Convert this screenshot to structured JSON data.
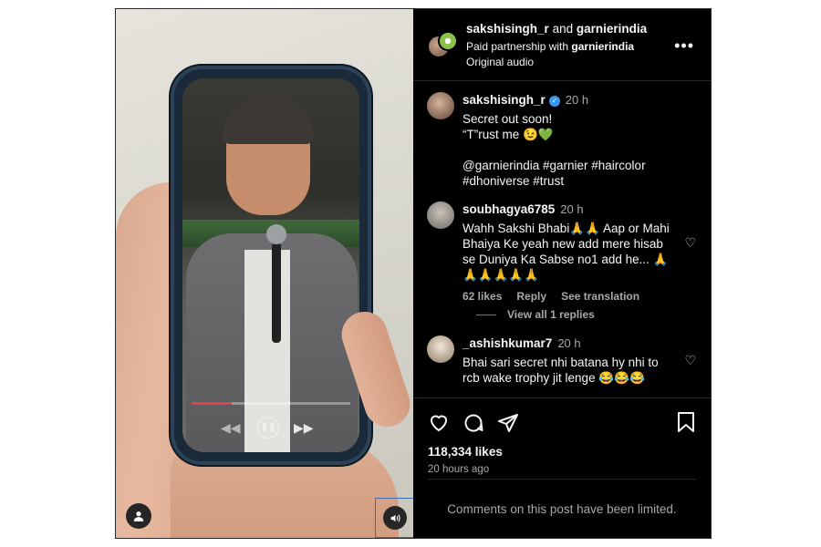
{
  "colors": {
    "background": "#000000",
    "text": "#f5f5f5",
    "muted": "#a8a8a8",
    "verified": "#3897f0",
    "divider": "#262626",
    "progress": "#e0434c"
  },
  "header": {
    "user1": "sakshisingh_r",
    "connector": "and",
    "user2": "garnierindia",
    "partnership_prefix": "Paid partnership with",
    "partnership_brand": "garnierindia",
    "audio": "Original audio",
    "more_icon": "more-horizontal-icon"
  },
  "caption": {
    "username": "sakshisingh_r",
    "time": "20 h",
    "text": "Secret out soon!\n“T”rust me 😉💚\n\n@garnierindia #garnier #haircolor\n#dhoniverse #trust"
  },
  "comments": [
    {
      "username": "soubhagya6785",
      "time": "20 h",
      "text": "Wahh Sakshi Bhabi🙏🙏 Aap or Mahi Bhaiya Ke yeah new add mere hisab se Duniya Ka Sabse no1 add he... 🙏\n🙏🙏🙏🙏🙏",
      "likes": "62 likes",
      "reply": "Reply",
      "translate": "See translation",
      "view_replies": "View all 1 replies"
    },
    {
      "username": "_ashishkumar7",
      "time": "20 h",
      "text": "Bhai sari secret nhi batana hy nhi to rcb wake trophy jit lenge 😂😂😂"
    }
  ],
  "actions": {
    "likes": "118,334 likes",
    "posted": "20 hours ago",
    "icons": [
      "heart-icon",
      "comment-icon",
      "share-icon",
      "bookmark-icon"
    ]
  },
  "footer": {
    "limited": "Comments on this post have been limited."
  },
  "video": {
    "progress_fraction": 0.25
  }
}
